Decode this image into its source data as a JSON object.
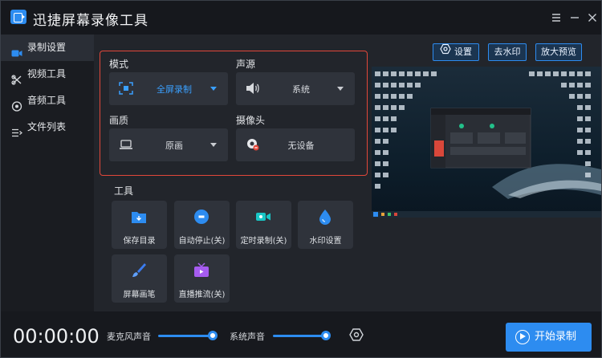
{
  "app": {
    "title": "迅捷屏幕录像工具"
  },
  "window_controls": {
    "menu_icon": "menu-icon",
    "minimize_icon": "minimize-icon",
    "close_icon": "close-icon"
  },
  "sidebar": {
    "items": [
      {
        "label": "录制设置",
        "icon": "record-camera-icon",
        "active": true
      },
      {
        "label": "视频工具",
        "icon": "video-tools-icon",
        "active": false
      },
      {
        "label": "音频工具",
        "icon": "audio-tools-icon",
        "active": false
      },
      {
        "label": "文件列表",
        "icon": "file-list-icon",
        "active": false
      }
    ]
  },
  "settings": {
    "mode": {
      "label": "模式",
      "value": "全屏录制"
    },
    "audio_source": {
      "label": "声源",
      "value": "系统"
    },
    "quality": {
      "label": "画质",
      "value": "原画"
    },
    "camera": {
      "label": "摄像头",
      "value": "无设备"
    }
  },
  "tools": {
    "label": "工具",
    "items": [
      {
        "label": "保存目录",
        "color": "#2d8cf0"
      },
      {
        "label": "自动停止(关)",
        "color": "#2d8cf0"
      },
      {
        "label": "定时录制(关)",
        "color": "#19c6c6"
      },
      {
        "label": "水印设置",
        "color": "#2d8cf0"
      },
      {
        "label": "屏幕画笔",
        "color": "#3b7cf0"
      },
      {
        "label": "直播推流(关)",
        "color": "#a65cf0"
      }
    ]
  },
  "top_buttons": {
    "settings": "设置",
    "remove_watermark": "去水印",
    "enlarge_preview": "放大预览"
  },
  "bottom": {
    "timer": "00:00:00",
    "mic_label": "麦克风声音",
    "system_label": "系统声音",
    "mic_level": 1.0,
    "system_level": 1.0,
    "start_label": "开始录制"
  },
  "colors": {
    "accent": "#2d8cf0",
    "highlight_border": "#e2473a"
  }
}
